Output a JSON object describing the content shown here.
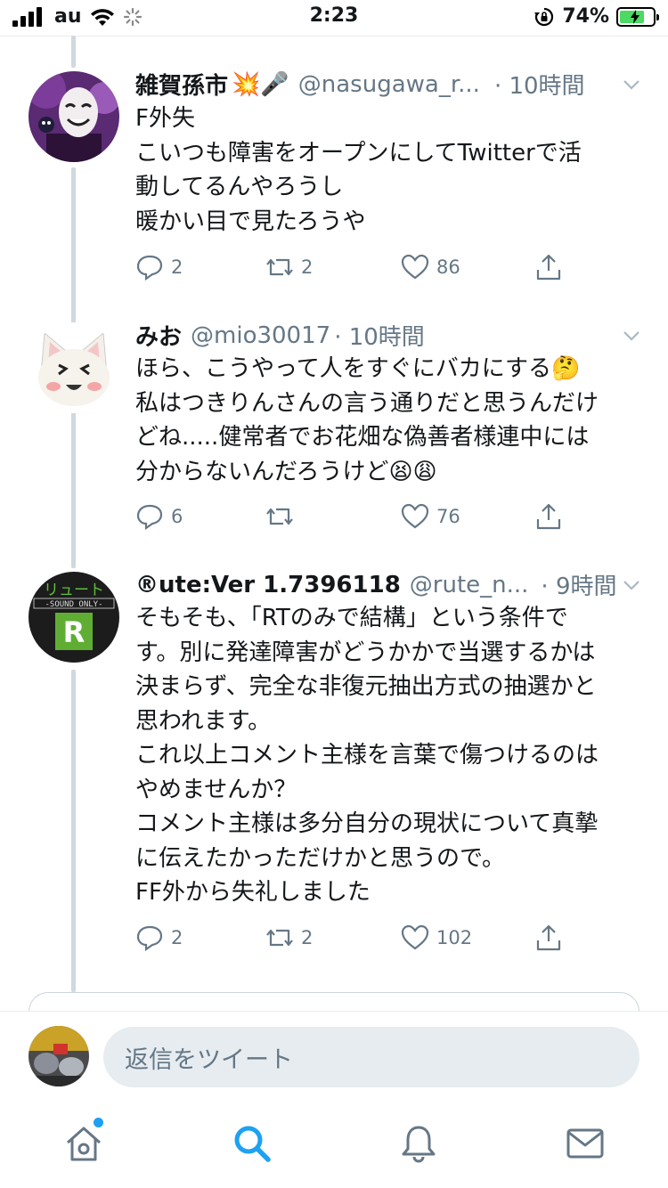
{
  "status_bar": {
    "carrier": "au",
    "time": "2:23",
    "battery_percent": "74%",
    "battery_level": 0.74
  },
  "tweets": [
    {
      "name": "雑賀孫市",
      "name_emoji": "💥🎤",
      "handle": "@nasugawa_r...",
      "time": "· 10時間",
      "lines": [
        "F外失",
        "こいつも障害をオープンにしてTwitterで活",
        "動してるんやろうし",
        "暖かい目で見たろうや"
      ],
      "replies": "2",
      "retweets": "2",
      "likes": "86"
    },
    {
      "name": "みお",
      "handle": "@mio30017",
      "time": "· 10時間",
      "lines": [
        "ほら、こうやって人をすぐにバカにする🤔",
        "私はつきりんさんの言う通りだと思うんだけ",
        "どね.....健常者でお花畑な偽善者様連中には",
        "分からないんだろうけど😫😩"
      ],
      "replies": "6",
      "retweets": "",
      "likes": "76"
    },
    {
      "name": "®ute:Ver 1.7396118",
      "handle": "@rute_n...",
      "time": "· 9時間",
      "lines": [
        "そもそも、「RTのみで結構」という条件で",
        "す。別に発達障害がどうかかで当選するかは",
        "決まらず、完全な非復元抽出方式の抽選かと",
        "思われます。",
        "これ以上コメント主様を言葉で傷つけるのは",
        "やめませんか？",
        "コメント主様は多分自分の現状について真摯",
        "に伝えたかっただけかと思うので。",
        "FF外から失礼しました"
      ],
      "replies": "2",
      "retweets": "2",
      "likes": "102"
    }
  ],
  "avatar_text": {
    "rute_top": "リュート",
    "rute_band": "-SOUND ONLY-",
    "rute_letter": "R"
  },
  "reply_bar": {
    "placeholder": "返信をツイート"
  },
  "tab_bar": {
    "active_tab": "search",
    "accent_color": "#1da1f2",
    "icons": [
      "home-icon",
      "search-icon",
      "bell-icon",
      "mail-icon"
    ]
  }
}
